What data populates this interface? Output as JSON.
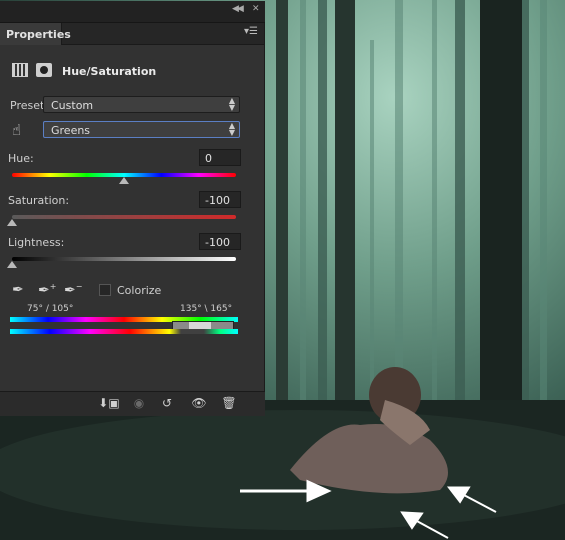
{
  "panel": {
    "tab_label": "Properties",
    "adjustment_title": "Hue/Saturation",
    "preset_label": "Preset:",
    "preset_value": "Custom",
    "channel_value": "Greens",
    "hue": {
      "label": "Hue:",
      "value": "0",
      "level": 0.5
    },
    "saturation": {
      "label": "Saturation:",
      "value": "-100",
      "level": 0
    },
    "lightness": {
      "label": "Lightness:",
      "value": "-100",
      "level": 0
    },
    "colorize_label": "Colorize",
    "colorize_checked": false,
    "range_left": "75° / 105°",
    "range_right": "135° \\ 165°"
  },
  "icons": {
    "collapse": "double-chevron-icon",
    "close": "close-icon",
    "menu": "panel-menu-icon",
    "adjustment": "hue-saturation-layer-icon",
    "mask": "layer-mask-icon",
    "targeted_adjustment": "hand-icon",
    "eyedroppers": [
      "eyedropper-icon",
      "eyedropper-add-icon",
      "eyedropper-subtract-icon"
    ],
    "bottom": [
      "clip-to-layer-icon",
      "view-previous-icon",
      "reset-icon",
      "visibility-icon",
      "trash-icon"
    ]
  },
  "colors": {
    "panel_bg": "#323232",
    "focus_outline": "#5b7fc4"
  }
}
